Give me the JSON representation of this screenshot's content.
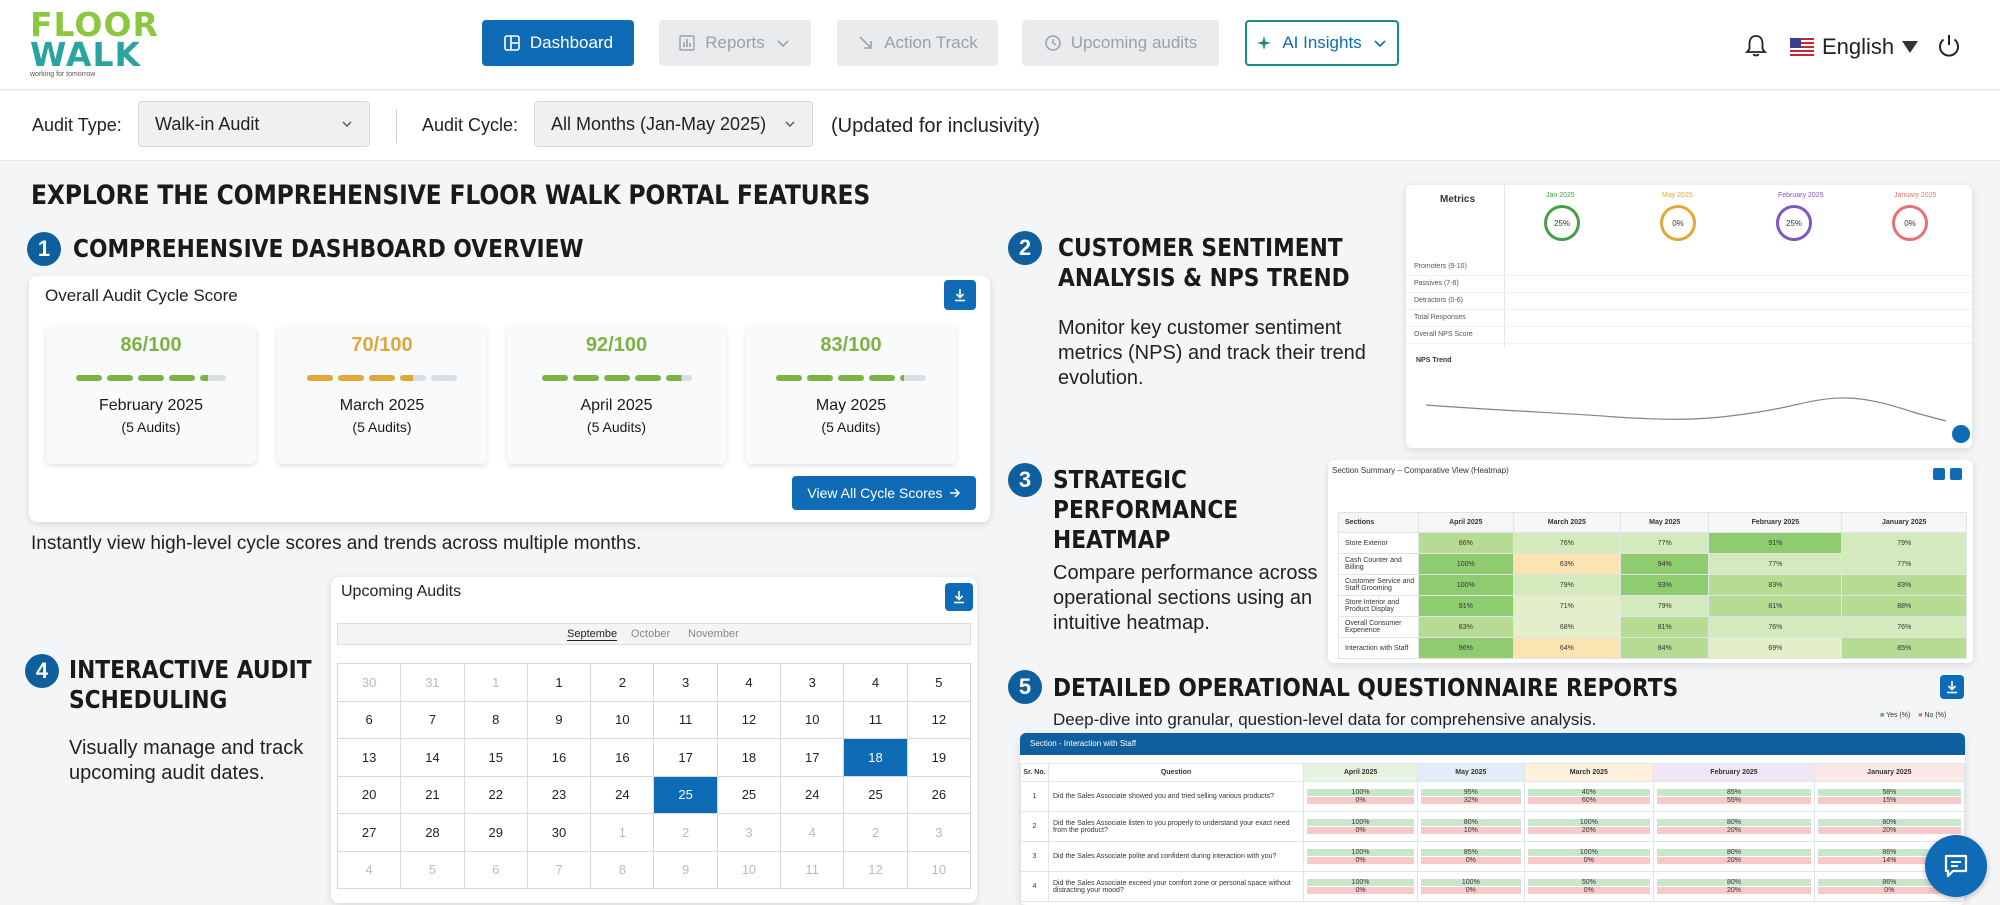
{
  "brand": {
    "line1": "FLOOR",
    "line2": "WALK",
    "tagline": "working for tomorrow"
  },
  "nav": [
    {
      "label": "Dashboard",
      "state": "active",
      "icon": "dashboard-icon"
    },
    {
      "label": "Reports",
      "state": "disabled",
      "icon": "chart-icon"
    },
    {
      "label": "Action Track",
      "state": "disabled",
      "icon": "arrow-icon"
    },
    {
      "label": "Upcoming audits",
      "state": "disabled",
      "icon": "clock-icon"
    },
    {
      "label": "AI Insights",
      "state": "highlighted",
      "icon": "sparkle-icon"
    }
  ],
  "header": {
    "language": "English",
    "icons": [
      "bell-icon",
      "flag-icon",
      "power-icon"
    ]
  },
  "filters": {
    "audit_type_label": "Audit Type:",
    "audit_type_value": "Walk-in Audit",
    "audit_cycle_label": "Audit Cycle:",
    "audit_cycle_value": "All Months (Jan-May 2025)",
    "note": "(Updated for inclusivity)"
  },
  "main_title": "EXPLORE THE COMPREHENSIVE FLOOR WALK PORTAL FEATURES",
  "sections": {
    "s1": {
      "num": "1",
      "title": "COMPREHENSIVE DASHBOARD OVERVIEW",
      "desc": "Instantly view high-level cycle scores and trends across multiple months."
    },
    "s2": {
      "num": "2",
      "title_line1": "CUSTOMER SENTIMENT",
      "title_line2": "ANALYSIS & NPS TREND",
      "desc": "Monitor key customer sentiment metrics (NPS) and track their trend evolution."
    },
    "s3": {
      "num": "3",
      "title_line1": "STRATEGIC",
      "title_line2": "PERFORMANCE",
      "title_line3": "HEATMAP",
      "desc": "Compare performance across operational sections using an intuitive heatmap."
    },
    "s4": {
      "num": "4",
      "title_line1": "INTERACTIVE AUDIT",
      "title_line2": "SCHEDULING",
      "desc": "Visually manage and track upcoming audit dates."
    },
    "s5": {
      "num": "5",
      "title": "DETAILED OPERATIONAL QUESTIONNAIRE REPORTS",
      "desc": "Deep-dive into granular, question-level data for comprehensive analysis."
    }
  },
  "score_card": {
    "title": "Overall Audit Cycle Score",
    "button": "View All Cycle Scores",
    "scores": [
      {
        "value": "86/100",
        "month": "February 2025",
        "audits": "(5 Audits)",
        "fraction": 0.86,
        "color": "#7cb342"
      },
      {
        "value": "70/100",
        "month": "March 2025",
        "audits": "(5 Audits)",
        "fraction": 0.7,
        "color": "#e0a83a"
      },
      {
        "value": "92/100",
        "month": "April 2025",
        "audits": "(5 Audits)",
        "fraction": 0.92,
        "color": "#7cb342"
      },
      {
        "value": "83/100",
        "month": "May 2025",
        "audits": "(5 Audits)",
        "fraction": 0.83,
        "color": "#7cb342"
      }
    ]
  },
  "calendar": {
    "title": "Upcoming Audits",
    "tabs": [
      "Septembe",
      "October",
      "November"
    ],
    "rows": [
      [
        "30",
        "31",
        "1",
        "1",
        "2",
        "3",
        "4",
        "3",
        "4",
        "5"
      ],
      [
        "6",
        "7",
        "8",
        "9",
        "10",
        "11",
        "12",
        "10",
        "11",
        "12"
      ],
      [
        "13",
        "14",
        "15",
        "16",
        "16",
        "17",
        "18",
        "17",
        "18",
        "19"
      ],
      [
        "20",
        "21",
        "22",
        "23",
        "24",
        "25",
        "25",
        "24",
        "25",
        "26"
      ],
      [
        "27",
        "28",
        "29",
        "30",
        "1",
        "2",
        "3",
        "4",
        "2",
        "3"
      ],
      [
        "4",
        "5",
        "6",
        "7",
        "8",
        "9",
        "10",
        "11",
        "12",
        "10"
      ]
    ],
    "muted": [
      [
        0,
        0
      ],
      [
        0,
        1
      ],
      [
        0,
        2
      ],
      [
        4,
        4
      ],
      [
        4,
        5
      ],
      [
        4,
        6
      ],
      [
        4,
        7
      ],
      [
        4,
        8
      ],
      [
        4,
        9
      ],
      [
        5,
        0
      ],
      [
        5,
        1
      ],
      [
        5,
        2
      ],
      [
        5,
        3
      ],
      [
        5,
        4
      ],
      [
        5,
        5
      ],
      [
        5,
        6
      ],
      [
        5,
        7
      ],
      [
        5,
        8
      ],
      [
        5,
        9
      ]
    ],
    "selected": [
      [
        2,
        8
      ],
      [
        3,
        5
      ]
    ]
  },
  "nps_preview": {
    "metrics_header": "Metrics",
    "months": [
      "Jan 2025",
      "May 2025",
      "February 2025",
      "January 2025"
    ],
    "gauges": [
      "25%",
      "0%",
      "25%",
      "0%"
    ],
    "rows": [
      "Promoters (9-10)",
      "Passives (7-8)",
      "Detractors (0-6)",
      "Total Responses",
      "Overall NPS Score"
    ],
    "trend_label": "NPS Trend"
  },
  "heatmap_preview": {
    "title": "Section Summary – Comparative View (Heatmap)",
    "columns": [
      "Sections",
      "April 2025",
      "March 2025",
      "May 2025",
      "February 2025",
      "January 2025"
    ],
    "rows": [
      {
        "name": "Store Exterior",
        "vals": [
          "86%",
          "76%",
          "77%",
          "91%",
          "79%"
        ]
      },
      {
        "name": "Cash Counter and Billing",
        "vals": [
          "100%",
          "63%",
          "94%",
          "77%",
          "77%"
        ]
      },
      {
        "name": "Customer Service and Staff Grooming",
        "vals": [
          "100%",
          "79%",
          "93%",
          "83%",
          "83%"
        ]
      },
      {
        "name": "Store Interior and Product Display",
        "vals": [
          "91%",
          "71%",
          "79%",
          "81%",
          "88%"
        ]
      },
      {
        "name": "Overall Consumer Experience",
        "vals": [
          "83%",
          "68%",
          "81%",
          "76%",
          "76%"
        ]
      },
      {
        "name": "Interaction with Staff",
        "vals": [
          "96%",
          "64%",
          "84%",
          "69%",
          "85%"
        ]
      }
    ]
  },
  "questionnaire_preview": {
    "section_bar": "Section - Interaction with Staff",
    "columns": [
      "Sr. No.",
      "Question",
      "April 2025",
      "May 2025",
      "March 2025",
      "February 2025",
      "January 2025"
    ],
    "legend": [
      "Yes (%)",
      "No (%)"
    ],
    "rows": [
      {
        "q": "Did the Sales Associate showed you and tried selling various products?",
        "yes": [
          "100%",
          "95%",
          "40%",
          "85%",
          "58%"
        ],
        "no": [
          "0%",
          "32%",
          "60%",
          "55%",
          "15%"
        ]
      },
      {
        "q": "Did the Sales Associate listen to you properly to understand your exact need from the product?",
        "yes": [
          "100%",
          "80%",
          "100%",
          "80%",
          "80%"
        ],
        "no": [
          "0%",
          "10%",
          "20%",
          "20%",
          "20%"
        ]
      },
      {
        "q": "Did the Sales Associate polite and confident during interaction with you?",
        "yes": [
          "100%",
          "85%",
          "100%",
          "80%",
          "86%"
        ],
        "no": [
          "0%",
          "0%",
          "0%",
          "20%",
          "14%"
        ]
      },
      {
        "q": "Did the Sales Associate exceed your comfort zone or personal space without distracting your mood?",
        "yes": [
          "100%",
          "100%",
          "50%",
          "80%",
          "86%"
        ],
        "no": [
          "0%",
          "0%",
          "0%",
          "20%",
          "0%"
        ]
      }
    ]
  }
}
